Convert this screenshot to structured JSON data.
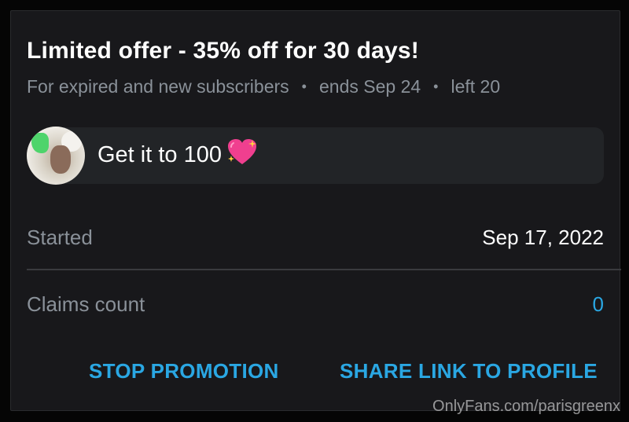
{
  "offer": {
    "title": "Limited offer - 35% off for 30 days!",
    "audience": "For expired and new subscribers",
    "ends": "ends Sep 24",
    "left": "left 20",
    "separator": "•"
  },
  "message": {
    "text": "Get it to 100",
    "emoji_icon": "sparkling-heart-icon"
  },
  "details": {
    "started_label": "Started",
    "started_value": "Sep 17, 2022",
    "claims_label": "Claims count",
    "claims_value": "0"
  },
  "actions": {
    "stop_label": "STOP PROMOTION",
    "share_label": "SHARE LINK TO PROFILE"
  },
  "watermark": "OnlyFans.com/parisgreenx",
  "colors": {
    "background": "#18181b",
    "accent": "#2aa7e3",
    "muted": "#8a9199",
    "bubble": "#222427"
  }
}
